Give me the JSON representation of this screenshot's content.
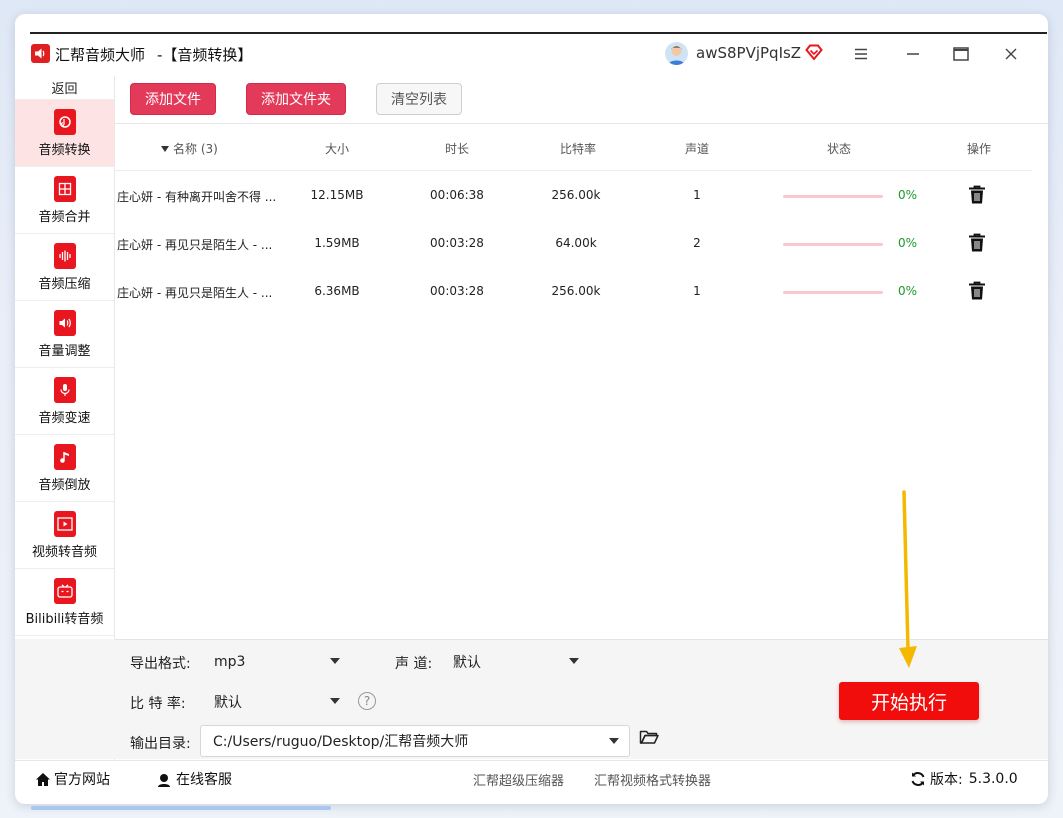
{
  "window": {
    "app_title": "汇帮音频大师",
    "module_title": "-【音频转换】",
    "username": "awS8PVjPqIsZ",
    "controls": {
      "menu_icon": "menu-icon",
      "minimize_icon": "minimize-icon",
      "maximize_icon": "maximize-icon",
      "close_icon": "close-icon"
    }
  },
  "sidebar": {
    "back_label": "返回",
    "items": [
      {
        "label": "音频转换",
        "icon": "audio-convert-icon",
        "active": true
      },
      {
        "label": "音频合并",
        "icon": "audio-merge-icon"
      },
      {
        "label": "音频压缩",
        "icon": "audio-compress-icon"
      },
      {
        "label": "音量调整",
        "icon": "volume-icon"
      },
      {
        "label": "音频变速",
        "icon": "microphone-icon"
      },
      {
        "label": "音频倒放",
        "icon": "music-note-icon"
      },
      {
        "label": "视频转音频",
        "icon": "film-icon"
      },
      {
        "label": "Bilibili转音频",
        "icon": "tv-icon"
      }
    ]
  },
  "toolbar": {
    "add_file": "添加文件",
    "add_folder": "添加文件夹",
    "clear_list": "清空列表"
  },
  "table": {
    "headers": {
      "name": "名称 (3)",
      "size": "大小",
      "duration": "时长",
      "bitrate": "比特率",
      "channels": "声道",
      "status": "状态",
      "actions": "操作"
    },
    "rows": [
      {
        "name": "庄心妍 - 有种离开叫舍不得 ...",
        "size": "12.15MB",
        "duration": "00:06:38",
        "bitrate": "256.00k",
        "channels": "1",
        "progress": "0%"
      },
      {
        "name": "庄心妍 - 再见只是陌生人 - ...",
        "size": "1.59MB",
        "duration": "00:03:28",
        "bitrate": "64.00k",
        "channels": "2",
        "progress": "0%"
      },
      {
        "name": "庄心妍 - 再见只是陌生人 - ...",
        "size": "6.36MB",
        "duration": "00:03:28",
        "bitrate": "256.00k",
        "channels": "1",
        "progress": "0%"
      }
    ]
  },
  "settings": {
    "format_label": "导出格式:",
    "format_value": "mp3",
    "channel_label": "声 道:",
    "channel_value": "默认",
    "bitrate_label": "比 特 率:",
    "bitrate_value": "默认",
    "output_label": "输出目录:",
    "output_value": "C:/Users/ruguo/Desktop/汇帮音频大师",
    "start_button": "开始执行"
  },
  "footer": {
    "website": "官方网站",
    "support": "在线客服",
    "link1": "汇帮超级压缩器",
    "link2": "汇帮视频格式转换器",
    "version_label": "版本:",
    "version_value": "5.3.0.0"
  },
  "colors": {
    "accent_red": "#e33a5a",
    "start_red": "#f20d0d",
    "progress_green": "#1a9b2a",
    "arrow_yellow": "#f5b800"
  }
}
